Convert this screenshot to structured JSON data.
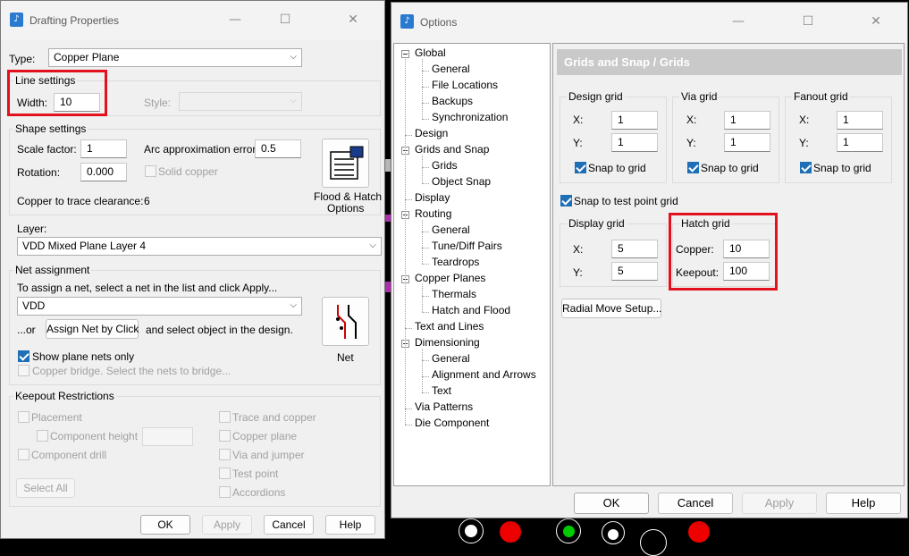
{
  "drafting": {
    "title": "Drafting Properties",
    "type_label": "Type:",
    "type_value": "Copper Plane",
    "line_settings": {
      "title": "Line settings",
      "width_label": "Width:",
      "width_value": "10",
      "style_label": "Style:",
      "style_value": ""
    },
    "shape_settings": {
      "title": "Shape settings",
      "scale_label": "Scale factor:",
      "scale_value": "1",
      "arc_label": "Arc approximation error:",
      "arc_value": "0.5",
      "rotation_label": "Rotation:",
      "rotation_value": "0.000",
      "solid_copper_label": "Solid copper",
      "clearance_label": "Copper to trace clearance:",
      "clearance_value": "6",
      "flood_hatch_label_1": "Flood & Hatch",
      "flood_hatch_label_2": "Options"
    },
    "layer": {
      "label": "Layer:",
      "value": "VDD Mixed Plane Layer 4"
    },
    "net_assignment": {
      "title": "Net assignment",
      "instruction": "To assign a net, select a net in the list and click Apply...",
      "net_value": "VDD",
      "or_label": "...or",
      "assign_button": "Assign Net by Click",
      "select_hint": "and select object in the design.",
      "show_plane_nets": "Show plane nets only",
      "copper_bridge": "Copper bridge. Select the nets to bridge...",
      "net_button_label": "Net"
    },
    "keepout": {
      "title": "Keepout Restrictions",
      "placement": "Placement",
      "component_height": "Component height",
      "component_drill": "Component drill",
      "select_all": "Select All",
      "trace_copper": "Trace and copper",
      "copper_plane": "Copper plane",
      "via_jumper": "Via and jumper",
      "test_point": "Test point",
      "accordions": "Accordions"
    },
    "buttons": {
      "ok": "OK",
      "apply": "Apply",
      "cancel": "Cancel",
      "help": "Help"
    }
  },
  "options": {
    "title": "Options",
    "tree": [
      {
        "label": "Global",
        "level": 0
      },
      {
        "label": "General",
        "level": 1
      },
      {
        "label": "File Locations",
        "level": 1
      },
      {
        "label": "Backups",
        "level": 1
      },
      {
        "label": "Synchronization",
        "level": 1
      },
      {
        "label": "Design",
        "level": 0
      },
      {
        "label": "Grids and Snap",
        "level": 0
      },
      {
        "label": "Grids",
        "level": 1
      },
      {
        "label": "Object Snap",
        "level": 1
      },
      {
        "label": "Display",
        "level": 0
      },
      {
        "label": "Routing",
        "level": 0
      },
      {
        "label": "General",
        "level": 1
      },
      {
        "label": "Tune/Diff Pairs",
        "level": 1
      },
      {
        "label": "Teardrops",
        "level": 1
      },
      {
        "label": "Copper Planes",
        "level": 0
      },
      {
        "label": "Thermals",
        "level": 1
      },
      {
        "label": "Hatch and Flood",
        "level": 1
      },
      {
        "label": "Text and Lines",
        "level": 0
      },
      {
        "label": "Dimensioning",
        "level": 0
      },
      {
        "label": "General",
        "level": 1
      },
      {
        "label": "Alignment and Arrows",
        "level": 1
      },
      {
        "label": "Text",
        "level": 1
      },
      {
        "label": "Via Patterns",
        "level": 0
      },
      {
        "label": "Die Component",
        "level": 0
      }
    ],
    "section_title": "Grids and Snap / Grids",
    "design_grid": {
      "title": "Design grid",
      "x_label": "X:",
      "x": "1",
      "y_label": "Y:",
      "y": "1",
      "snap": "Snap to grid"
    },
    "via_grid": {
      "title": "Via grid",
      "x_label": "X:",
      "x": "1",
      "y_label": "Y:",
      "y": "1",
      "snap": "Snap to grid"
    },
    "fanout_grid": {
      "title": "Fanout grid",
      "x_label": "X:",
      "x": "1",
      "y_label": "Y:",
      "y": "1",
      "snap": "Snap to grid"
    },
    "snap_test_point": "Snap to test point grid",
    "display_grid": {
      "title": "Display grid",
      "x_label": "X:",
      "x": "5",
      "y_label": "Y:",
      "y": "5"
    },
    "hatch_grid": {
      "title": "Hatch grid",
      "copper_label": "Copper:",
      "copper": "10",
      "keepout_label": "Keepout:",
      "keepout": "100"
    },
    "radial_button": "Radial Move Setup...",
    "buttons": {
      "ok": "OK",
      "cancel": "Cancel",
      "apply": "Apply",
      "help": "Help"
    }
  },
  "colors": {
    "highlight": "#e3101e",
    "checkbox": "#1f6fb6"
  }
}
